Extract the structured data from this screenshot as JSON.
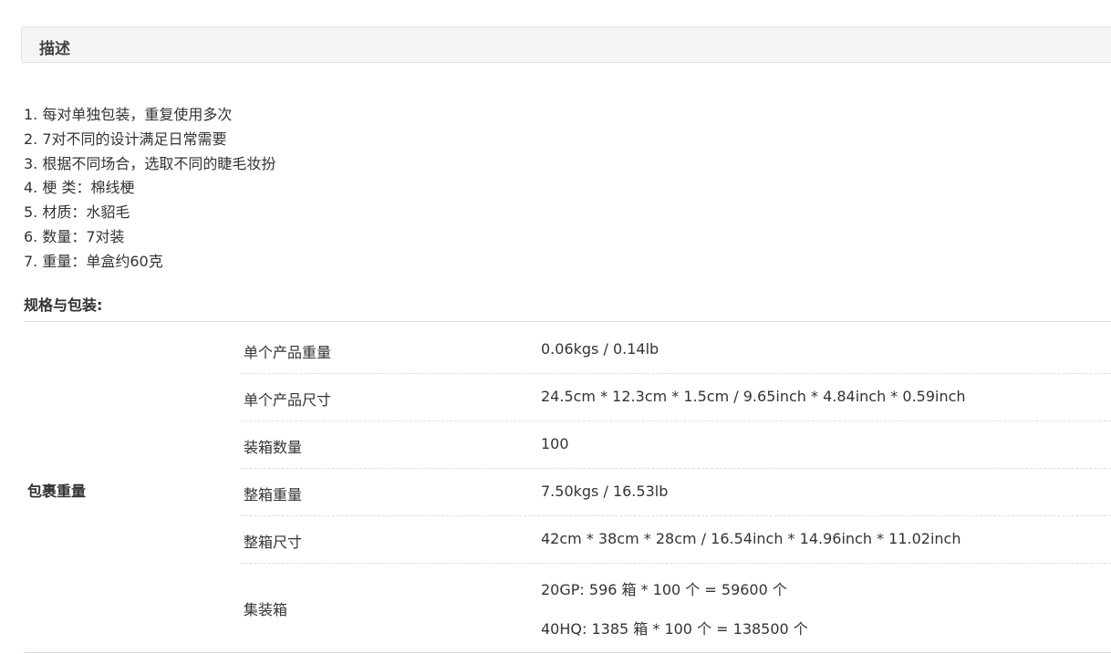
{
  "description": {
    "header_title": "描述",
    "features": [
      "1. 每对单独包装，重复使用多次",
      "2. 7对不同的设计满足日常需要",
      "3. 根据不同场合，选取不同的睫毛妆扮",
      "4. 梗 类：棉线梗",
      "5. 材质：水貂毛",
      "6. 数量：7对装",
      "7. 重量：单盒约60克"
    ]
  },
  "specs": {
    "title": "规格与包装:",
    "group_label": "包裹重量",
    "rows": [
      {
        "key": "单个产品重量",
        "value": "0.06kgs / 0.14lb"
      },
      {
        "key": "单个产品尺寸",
        "value": "24.5cm * 12.3cm * 1.5cm / 9.65inch * 4.84inch * 0.59inch"
      },
      {
        "key": "装箱数量",
        "value": "100"
      },
      {
        "key": "整箱重量",
        "value": "7.50kgs / 16.53lb"
      },
      {
        "key": "整箱尺寸",
        "value": "42cm * 38cm * 28cm / 16.54inch * 14.96inch * 11.02inch"
      },
      {
        "key": "集装箱",
        "value": "20GP: 596 箱 * 100 个 = 59600 个",
        "value2": "40HQ: 1385 箱 * 100 个 = 138500 个"
      }
    ]
  }
}
